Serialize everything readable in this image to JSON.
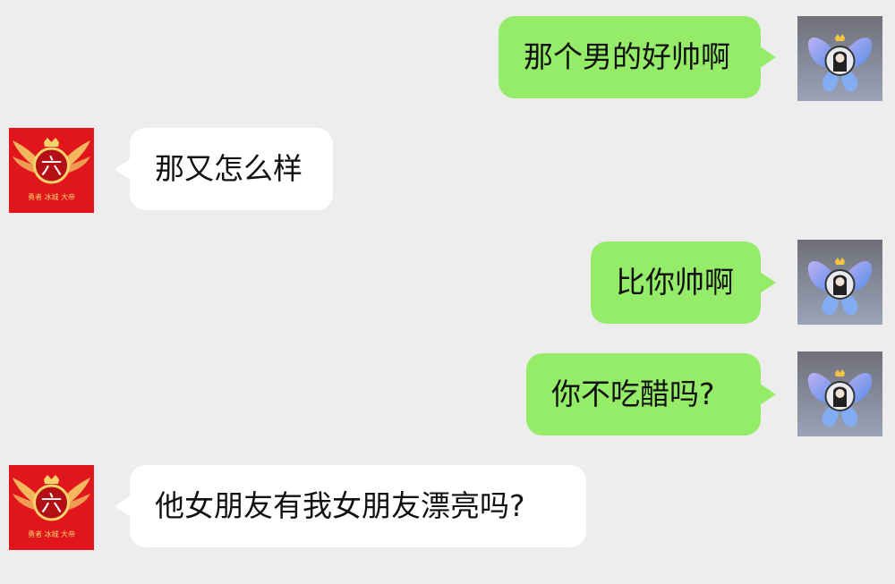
{
  "messages": [
    {
      "side": "sent",
      "text": "那个男的好帅啊"
    },
    {
      "side": "received",
      "text": "那又怎么样"
    },
    {
      "side": "sent",
      "text": "比你帅啊"
    },
    {
      "side": "sent",
      "text": "你不吃醋吗?"
    },
    {
      "side": "received",
      "text": "他女朋友有我女朋友漂亮吗?"
    }
  ],
  "avatars": {
    "sent": {
      "icon": "butterfly-avatar-icon"
    },
    "received": {
      "icon": "red-badge-avatar-icon",
      "glyph": "六",
      "caption": "勇者 冰城 大帝"
    }
  },
  "colors": {
    "background": "#ededed",
    "sent_bubble": "#95ec69",
    "received_bubble": "#ffffff",
    "received_avatar": "#e0161c"
  }
}
